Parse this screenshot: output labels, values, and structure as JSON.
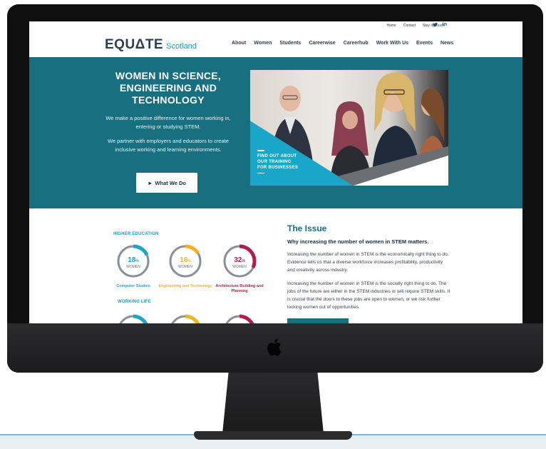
{
  "topbar": {
    "links": [
      "Home",
      "Contact",
      "Stay in Touch"
    ],
    "social": [
      "twitter-icon",
      "linkedin-icon"
    ],
    "twitter_glyph": "🐦",
    "linkedin_glyph": "in"
  },
  "brand": {
    "name": "EQUΔTE",
    "sub": "Scotland"
  },
  "nav": [
    "About",
    "Women",
    "Students",
    "Careerwise",
    "Careerhub",
    "Work With Us",
    "Events",
    "News"
  ],
  "hero": {
    "title": "WOMEN IN SCIENCE, ENGINEERING AND TECHNOLOGY",
    "p1": "We make a positive difference for women working in, entering or studying STEM.",
    "p2": "We partner with employers and educators to create inclusive working and learning environments.",
    "button": "What We Do",
    "button_icon": "►",
    "photo_cta": [
      "FIND OUT ABOUT",
      "OUR TRAINING",
      "FOR BUSINESSES"
    ]
  },
  "stats": {
    "higher_education_heading": "HIGHER EDUCATION",
    "working_life_heading": "WORKING LIFE",
    "items": [
      {
        "pct": "18",
        "unit": "%",
        "word": "WOMEN",
        "label": "Computer Studies",
        "color": "#1aa6c9",
        "fraction": 0.18
      },
      {
        "pct": "16",
        "unit": "%",
        "word": "WOMEN",
        "label": "Engineering and Technology",
        "color": "#f1b324",
        "fraction": 0.16
      },
      {
        "pct": "32",
        "unit": "%",
        "word": "WOMEN",
        "label": "Architecture Building and Planning",
        "color": "#b01f4b",
        "fraction": 0.32
      }
    ],
    "working_colors": [
      "#1aa6c9",
      "#f1b324",
      "#b01f4b"
    ]
  },
  "issue": {
    "title": "The Issue",
    "subtitle": "Why increasing the number of women in STEM matters.",
    "p1": "Increasing the number of women in STEM is the economically right thing to do. Evidence tells us that a diverse workforce increases profitability, productivity and creativity across industry.",
    "p2": "Increasing the number of women in STEM is the socially right thing to do. The jobs of the future are either in the STEM industries or will require STEM skills. It is crucial that the doors to these jobs are open to women, or we risk further locking women out of opportunities."
  },
  "colors": {
    "teal": "#176f80",
    "cyan": "#1e9bc1",
    "navy": "#2c3e55"
  },
  "device": {
    "logo_glyph": ""
  }
}
